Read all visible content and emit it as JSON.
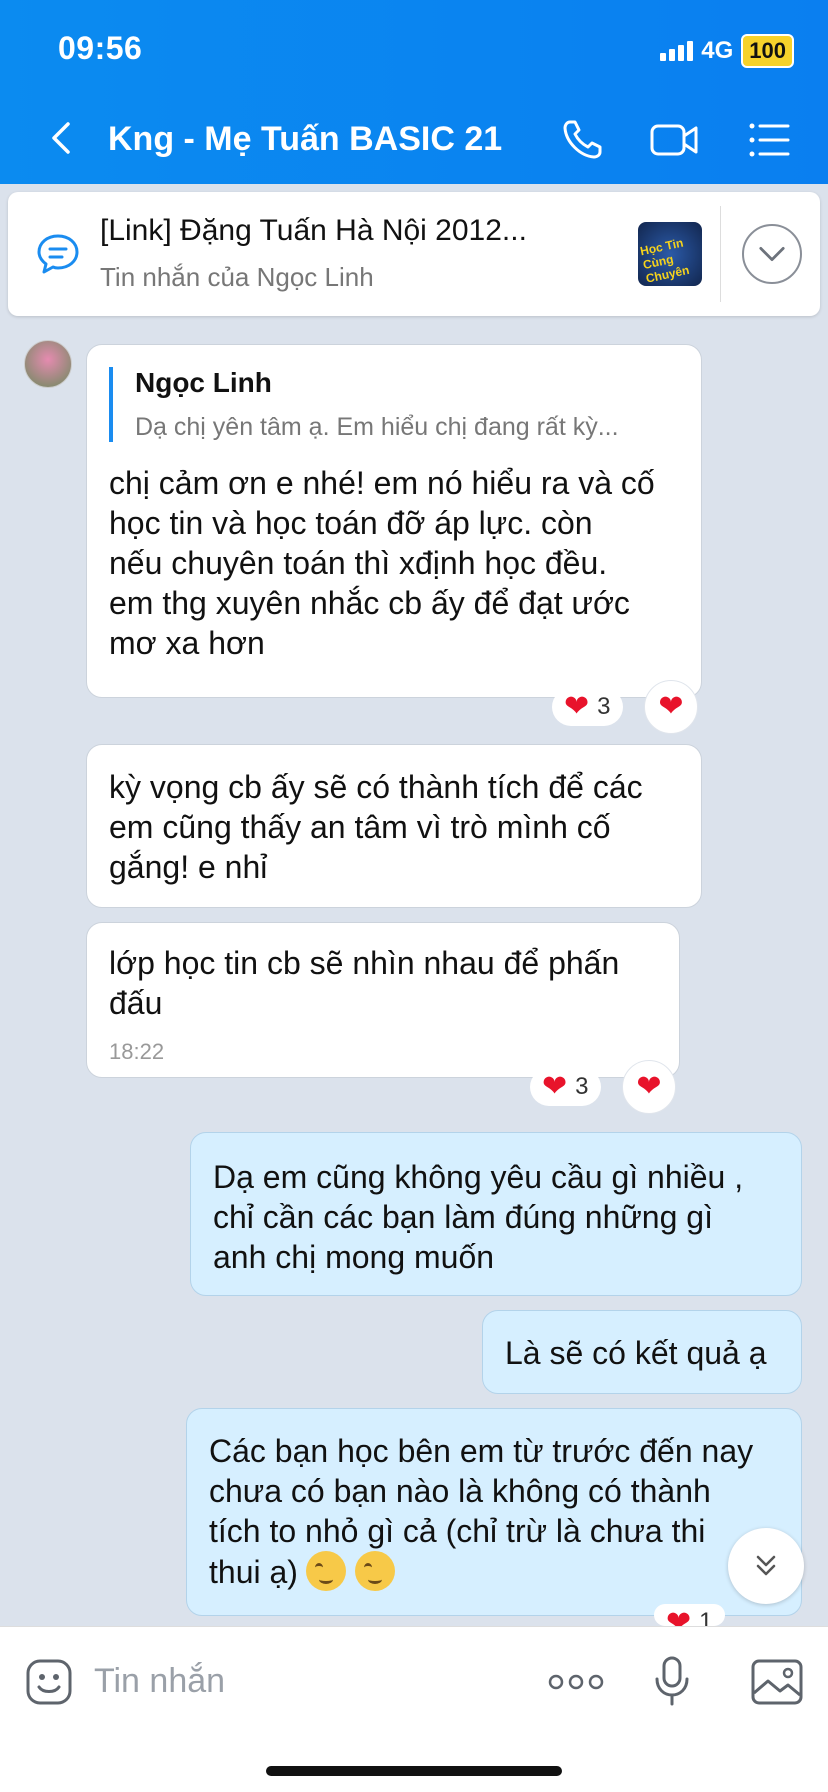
{
  "status_bar": {
    "time": "09:56",
    "network": "4G",
    "battery": "100"
  },
  "header": {
    "title": "Kng - Mẹ Tuấn BASIC 21"
  },
  "pinned": {
    "title": "[Link] Đặng Tuấn Hà Nội 2012...",
    "subtitle": "Tin nhắn của Ngọc Linh",
    "thumb_text": "Học Tin Cùng Chuyên Tin"
  },
  "messages": [
    {
      "quote_name": "Ngọc Linh",
      "quote_text": "Dạ chị yên tâm ạ. Em hiểu chị đang rất kỳ...",
      "text": "chị cảm ơn e nhé! em nó hiểu ra và cố\nhọc tin và học toán đỡ áp lực. còn\nnếu chuyên toán thì xđịnh học đều.\nem thg xuyên nhắc cb ấy để đạt ước\nmơ xa hơn",
      "reaction_count": "3"
    },
    {
      "text": "kỳ vọng cb ấy sẽ có thành tích để các\nem cũng thấy an tâm vì trò mình cố\ngắng! e nhỉ"
    },
    {
      "text": "lớp học tin cb sẽ nhìn nhau để phấn\nđấu",
      "time": "18:22",
      "reaction_count": "3"
    },
    {
      "text": "Dạ em cũng không yêu cầu gì nhiều ,\nchỉ cần các bạn làm đúng những gì\nanh chị mong muốn"
    },
    {
      "text": "Là sẽ có kết quả ạ"
    },
    {
      "text": "Các bạn học bên em từ trước đến nay\nchưa có bạn nào là không có thành\ntích to nhỏ gì cả (chỉ trừ là chưa thi\nthui ạ)",
      "reaction_count": "1"
    }
  ],
  "input": {
    "placeholder": "Tin nhắn"
  },
  "icons": {
    "back": "chevron-left-icon",
    "call": "phone-icon",
    "video": "video-camera-icon",
    "menu": "list-menu-icon",
    "pinned": "chat-bubble-icon",
    "expand": "chevron-down-icon",
    "reaction": "heart-icon",
    "scroll_down": "double-chevron-down-icon",
    "sticker": "sticker-icon",
    "more": "more-dots-icon",
    "mic": "microphone-icon",
    "image": "image-icon"
  },
  "colors": {
    "header": "#0b8bf0",
    "bubble_mine": "#d6efff",
    "heart": "#e8132b",
    "battery": "#f6d22b"
  }
}
